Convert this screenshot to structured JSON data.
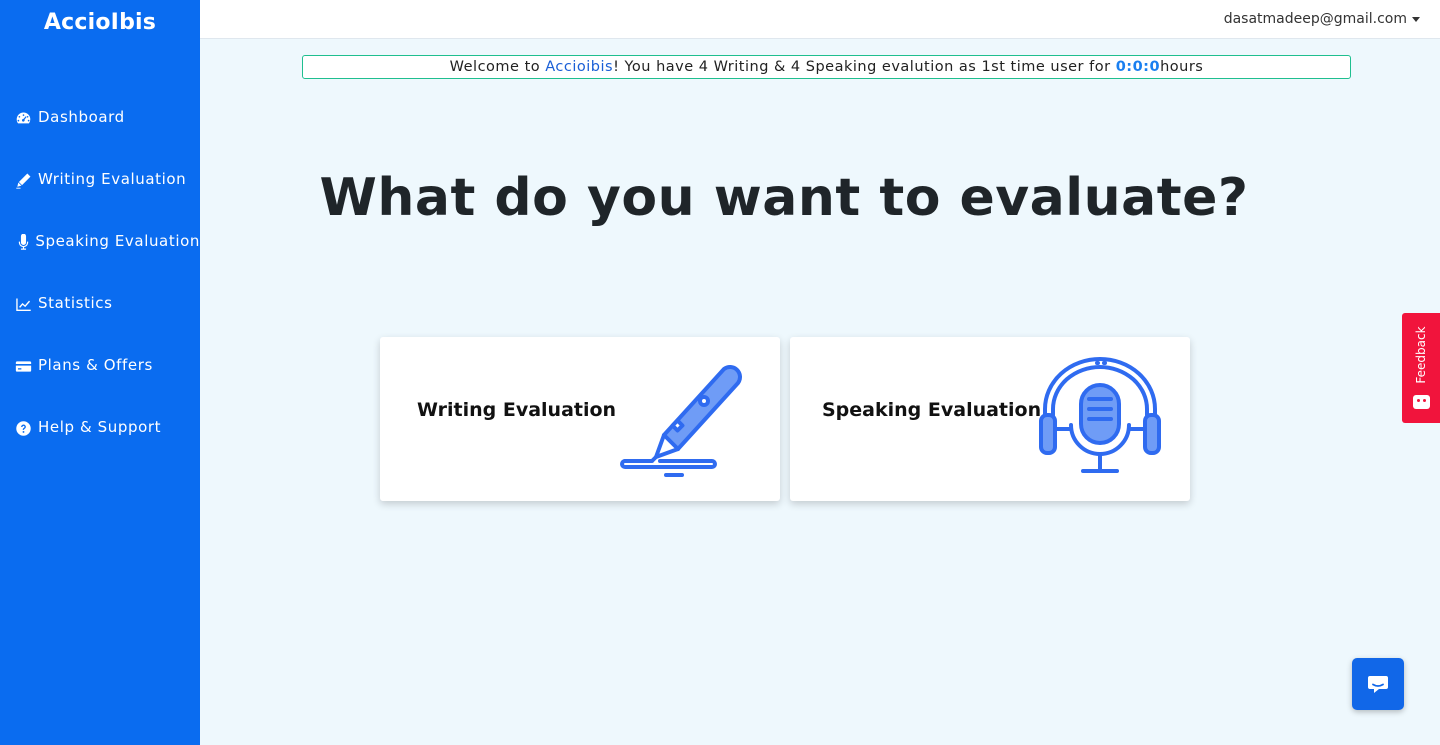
{
  "sidebar": {
    "brand": "AccioIbis",
    "items": [
      {
        "label": "Dashboard",
        "icon": "dashboard-gauge-icon"
      },
      {
        "label": "Writing Evaluation",
        "icon": "pencil-icon"
      },
      {
        "label": "Speaking Evaluation",
        "icon": "microphone-icon"
      },
      {
        "label": "Statistics",
        "icon": "line-chart-icon"
      },
      {
        "label": "Plans & Offers",
        "icon": "credit-card-icon"
      },
      {
        "label": "Help & Support",
        "icon": "question-circle-icon"
      }
    ]
  },
  "topbar": {
    "user_email": "dasatmadeep@gmail.com"
  },
  "banner": {
    "prefix": "Welcome to ",
    "brand": "Accioibis",
    "middle": "! You have 4 Writing & 4 Speaking evalution as 1st time user for ",
    "timer": "0:0:0",
    "suffix": "hours"
  },
  "main": {
    "headline": "What do you want to evaluate?",
    "cards": [
      {
        "label": "Writing Evaluation",
        "icon": "pen-illustration-icon"
      },
      {
        "label": "Speaking Evaluation",
        "icon": "microphone-headphones-illustration-icon"
      }
    ]
  },
  "feedback": {
    "label": "Feedback"
  },
  "colors": {
    "sidebar": "#0a6cf0",
    "page_background": "#eef8fd",
    "banner_border": "#1fbf8f",
    "feedback": "#f1143c",
    "chat_button": "#1167e8",
    "illustration_blue": "#2f6bf0"
  }
}
